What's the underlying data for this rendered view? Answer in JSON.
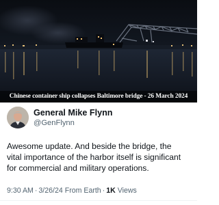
{
  "photo": {
    "caption": "Chinese container ship collapses Baltimore bridge - 26 March 2024"
  },
  "tweet": {
    "author": {
      "display_name": "General Mike Flynn",
      "handle": "@GenFlynn"
    },
    "text_lines": [
      "Awesome update. And beside the bridge, the",
      "vital importance of the harbor itself is significant",
      "for commercial and military operations."
    ],
    "time": "9:30 AM",
    "date": "3/26/24",
    "source": "From Earth",
    "separator": "·",
    "views_count": "1K",
    "views_label": "Views"
  },
  "colors": {
    "text_primary": "#0f1419",
    "text_secondary": "#536471",
    "photo_sky": "#0b0e14",
    "photo_water": "#1a2130"
  },
  "icons": {
    "avatar": "person-portrait"
  }
}
